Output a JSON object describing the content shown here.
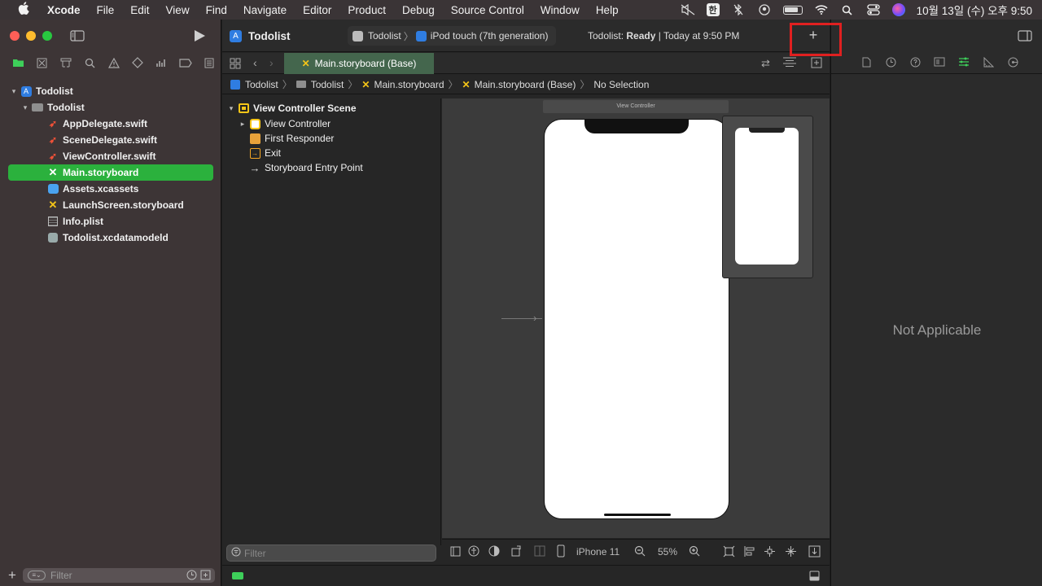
{
  "menubar": {
    "app": "Xcode",
    "items": [
      "File",
      "Edit",
      "View",
      "Find",
      "Navigate",
      "Editor",
      "Product",
      "Debug",
      "Source Control",
      "Window",
      "Help"
    ],
    "input_source": "한",
    "datetime": "10월 13일 (수) 오후 9:50"
  },
  "navigator": {
    "items": [
      {
        "label": "Todolist",
        "level": 0,
        "icon": "project-icon",
        "disclosure": "▾"
      },
      {
        "label": "Todolist",
        "level": 1,
        "icon": "folder-icon",
        "disclosure": "▾"
      },
      {
        "label": "AppDelegate.swift",
        "level": 2,
        "icon": "swift-icon"
      },
      {
        "label": "SceneDelegate.swift",
        "level": 2,
        "icon": "swift-icon"
      },
      {
        "label": "ViewController.swift",
        "level": 2,
        "icon": "swift-icon"
      },
      {
        "label": "Main.storyboard",
        "level": 2,
        "icon": "storyboard-icon",
        "selected": true
      },
      {
        "label": "Assets.xcassets",
        "level": 2,
        "icon": "assets-icon"
      },
      {
        "label": "LaunchScreen.storyboard",
        "level": 2,
        "icon": "storyboard-icon"
      },
      {
        "label": "Info.plist",
        "level": 2,
        "icon": "plist-icon"
      },
      {
        "label": "Todolist.xcdatamodeld",
        "level": 2,
        "icon": "datamodel-icon"
      }
    ],
    "filter_placeholder": "Filter"
  },
  "toolbar": {
    "project_title": "Todolist",
    "scheme": "Todolist",
    "destination": "iPod touch (7th generation)",
    "status_prefix": "Todolist: ",
    "status_bold": "Ready",
    "status_suffix": " | Today at 9:50 PM",
    "add_label": "+"
  },
  "editor": {
    "tab_label": "Main.storyboard (Base)",
    "jumpbar": [
      "Todolist",
      "Todolist",
      "Main.storyboard",
      "Main.storyboard (Base)",
      "No Selection"
    ],
    "outline": {
      "scene": "View Controller Scene",
      "items": [
        "View Controller",
        "First Responder",
        "Exit",
        "Storyboard Entry Point"
      ],
      "filter_placeholder": "Filter"
    },
    "canvas": {
      "scene_title": "View Controller"
    },
    "bottom": {
      "device": "iPhone 11",
      "zoom": "55%"
    }
  },
  "inspector": {
    "message": "Not Applicable"
  },
  "colors": {
    "selection": "#2bb13d",
    "accent_green": "#3ecf5a",
    "highlight": "#e02020"
  }
}
